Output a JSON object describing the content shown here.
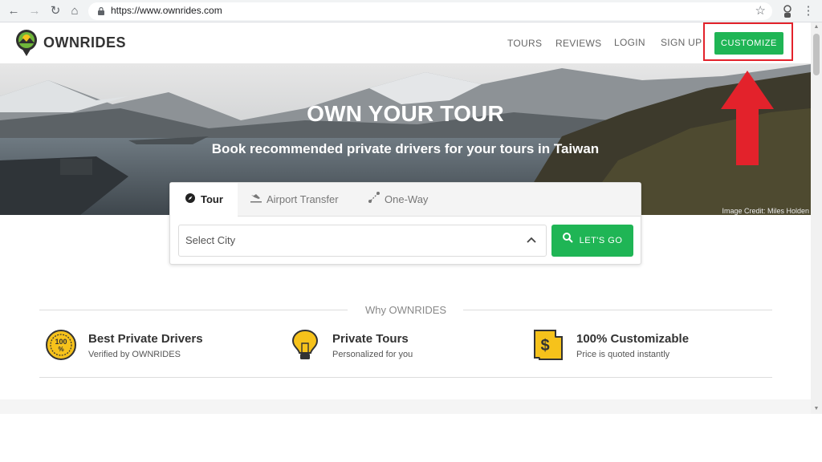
{
  "browser": {
    "url": "https://www.ownrides.com",
    "icons": [
      "back-icon",
      "forward-icon",
      "reload-icon",
      "home-icon",
      "lock-icon",
      "star-icon",
      "menu-icon"
    ]
  },
  "header": {
    "brand": "OWNRIDES",
    "nav": [
      "TOURS",
      "REVIEWS",
      "LOGIN",
      "SIGN UP"
    ],
    "cta": "CUSTOMIZE"
  },
  "hero": {
    "title": "OWN YOUR TOUR",
    "subtitle": "Book recommended private drivers for your tours in Taiwan",
    "credit": "Image Credit: Miles Holden"
  },
  "search": {
    "tabs": [
      {
        "label": "Tour",
        "icon": "compass-icon",
        "active": true
      },
      {
        "label": "Airport Transfer",
        "icon": "plane-landing-icon",
        "active": false
      },
      {
        "label": "One-Way",
        "icon": "route-icon",
        "active": false
      }
    ],
    "city_placeholder": "Select City",
    "go_label": "LET'S GO"
  },
  "why": {
    "heading": "Why OWNRIDES",
    "features": [
      {
        "title": "Best Private Drivers",
        "subtitle": "Verified by OWNRIDES",
        "icon": "badge-100-percent-icon"
      },
      {
        "title": "Private Tours",
        "subtitle": "Personalized for you",
        "icon": "lightbulb-icon"
      },
      {
        "title": "100% Customizable",
        "subtitle": "Price is quoted instantly",
        "icon": "price-tag-dollar-icon"
      }
    ]
  },
  "colors": {
    "accent_green": "#1fb555",
    "highlight_red": "#e3222b"
  }
}
